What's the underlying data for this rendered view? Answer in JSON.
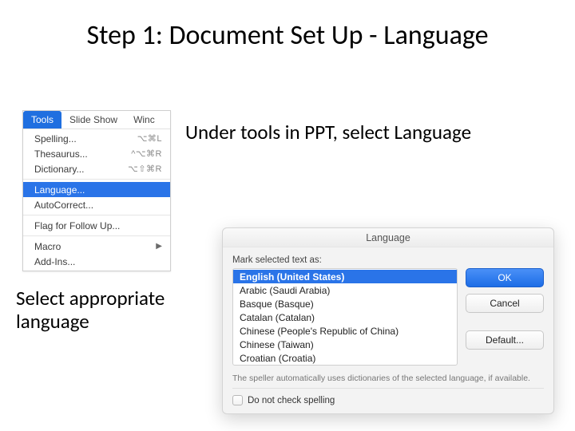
{
  "title": "Step 1: Document Set Up - Language",
  "instruction1": "Under tools in PPT, select Language",
  "instruction2": "Select appropriate language",
  "menu": {
    "tabs": {
      "tools": "Tools",
      "slideshow": "Slide Show",
      "window": "Winc"
    },
    "items": {
      "spelling": {
        "label": "Spelling...",
        "shortcut": "⌥⌘L"
      },
      "thesaurus": {
        "label": "Thesaurus...",
        "shortcut": "^⌥⌘R"
      },
      "dictionary": {
        "label": "Dictionary...",
        "shortcut": "⌥⇧⌘R"
      },
      "language": {
        "label": "Language..."
      },
      "autocorrect": {
        "label": "AutoCorrect..."
      },
      "flag": {
        "label": "Flag for Follow Up..."
      },
      "macro": {
        "label": "Macro"
      },
      "addins": {
        "label": "Add-Ins..."
      }
    }
  },
  "dialog": {
    "title": "Language",
    "label": "Mark selected text as:",
    "options": [
      "English (United States)",
      "Arabic (Saudi Arabia)",
      "Basque (Basque)",
      "Catalan (Catalan)",
      "Chinese (People's Republic of China)",
      "Chinese (Taiwan)",
      "Croatian (Croatia)"
    ],
    "buttons": {
      "ok": "OK",
      "cancel": "Cancel",
      "default": "Default..."
    },
    "hint": "The speller automatically uses dictionaries of the selected language, if available.",
    "checkbox": "Do not check spelling"
  }
}
